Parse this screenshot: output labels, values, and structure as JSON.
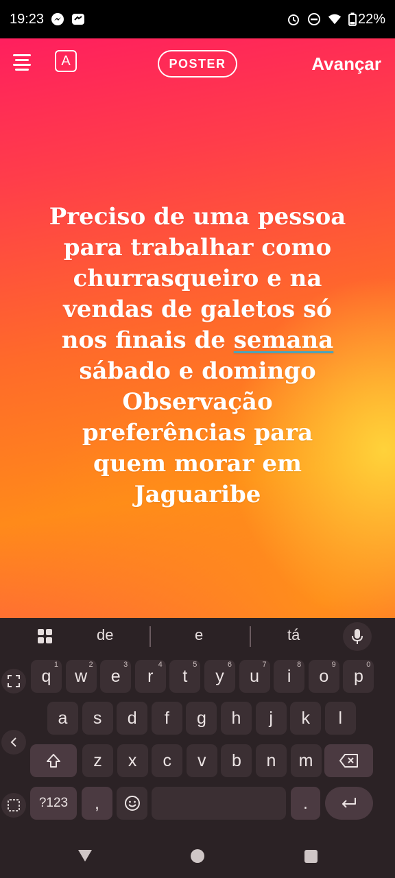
{
  "status_bar": {
    "time": "19:23",
    "battery": "22%",
    "icons": [
      "messenger-icon",
      "app-notification-icon",
      "alarm-icon",
      "dnd-icon",
      "wifi-icon",
      "battery-icon"
    ]
  },
  "toolbar": {
    "menu_icon": "menu-icon",
    "font_label": "A",
    "style_label": "POSTER",
    "next_label": "Avançar"
  },
  "story": {
    "lines": [
      "Preciso de uma pessoa",
      "para trabalhar como",
      "churrasqueiro e na",
      "vendas de galetos só",
      "nos finais de ",
      "sábado e domingo",
      "Observação",
      "preferências para",
      "quem morar em",
      "Jaguaribe"
    ],
    "underlined_word": "semana",
    "gradient_colors": [
      "#ff1f5e",
      "#ff6a2a",
      "#ffd63c"
    ]
  },
  "keyboard": {
    "suggestions": [
      "de",
      "e",
      "tá"
    ],
    "row1": [
      {
        "k": "q",
        "h": "1"
      },
      {
        "k": "w",
        "h": "2"
      },
      {
        "k": "e",
        "h": "3"
      },
      {
        "k": "r",
        "h": "4"
      },
      {
        "k": "t",
        "h": "5"
      },
      {
        "k": "y",
        "h": "6"
      },
      {
        "k": "u",
        "h": "7"
      },
      {
        "k": "i",
        "h": "8"
      },
      {
        "k": "o",
        "h": "9"
      },
      {
        "k": "p",
        "h": "0"
      }
    ],
    "row2": [
      "a",
      "s",
      "d",
      "f",
      "g",
      "h",
      "j",
      "k",
      "l"
    ],
    "row3": [
      "z",
      "x",
      "c",
      "v",
      "b",
      "n",
      "m"
    ],
    "symbols_label": "?123",
    "comma_label": ",",
    "period_label": "."
  }
}
